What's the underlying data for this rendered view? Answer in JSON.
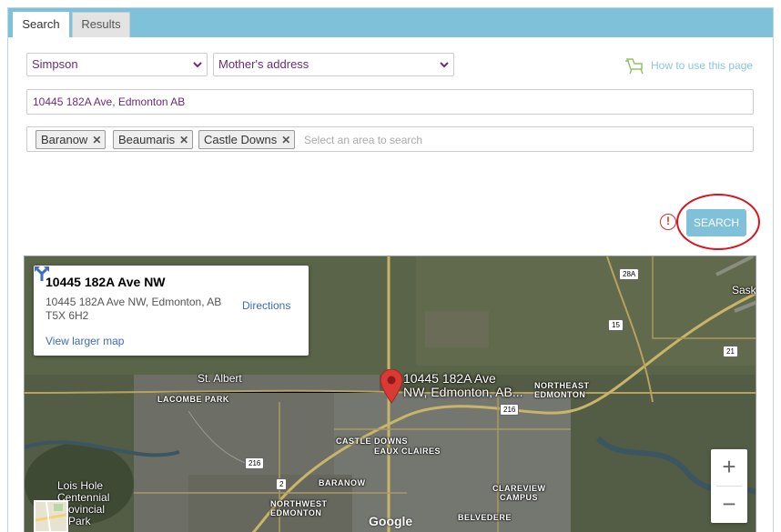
{
  "tabs": [
    {
      "label": "Search",
      "active": true
    },
    {
      "label": "Results",
      "active": false
    }
  ],
  "form": {
    "name_select": "Simpson",
    "address_type_select": "Mother's address",
    "how_to_link": "How to use this page",
    "address_value": "10445 182A Ave, Edmonton AB",
    "areas": [
      "Baranow",
      "Beaumaris",
      "Castle Downs"
    ],
    "area_placeholder": "Select an area to search",
    "warning_glyph": "!",
    "search_button": "SEARCH"
  },
  "map": {
    "info_title": "10445 182A Ave NW",
    "info_address_line1": "10445 182A Ave NW, Edmonton, AB",
    "info_address_line2": "T5X 6H2",
    "view_larger": "View larger map",
    "directions": "Directions",
    "pin_label_line1": "10445 182A Ave",
    "pin_label_line2": "NW, Edmonton, AB...",
    "places": {
      "st_albert": "St. Albert",
      "lacombe_park": "LACOMBE PARK",
      "castle_downs": "CASTLE DOWNS",
      "eaux_claires": "EAUX CLAIRES",
      "baranow": "BARANOW",
      "northeast_edmonton_1": "NORTHEAST",
      "northeast_edmonton_2": "EDMONTON",
      "northwest_edmonton_1": "NORTHWEST",
      "northwest_edmonton_2": "EDMONTON",
      "clareview_1": "CLAREVIEW",
      "clareview_2": "CAMPUS",
      "belvedere": "BELVEDERE",
      "lois_hole_1": "Lois Hole",
      "lois_hole_2": "Centennial",
      "lois_hole_3": "Provincial",
      "lois_hole_4": "Park",
      "sask": "Sask"
    },
    "shields": {
      "s28a": "28A",
      "s15": "15",
      "s21": "21",
      "s216a": "216",
      "s216b": "216",
      "s2": "2"
    },
    "zoom_in": "+",
    "zoom_out": "−",
    "attribution": "Google"
  },
  "colors": {
    "tab_bar": "#7fc1d9",
    "select_text": "#6a2c7a",
    "search_button": "#7fc1d9",
    "highlight_ring": "#d8141f",
    "link_blue": "#3b6bc3",
    "pin_red": "#d93a36"
  }
}
